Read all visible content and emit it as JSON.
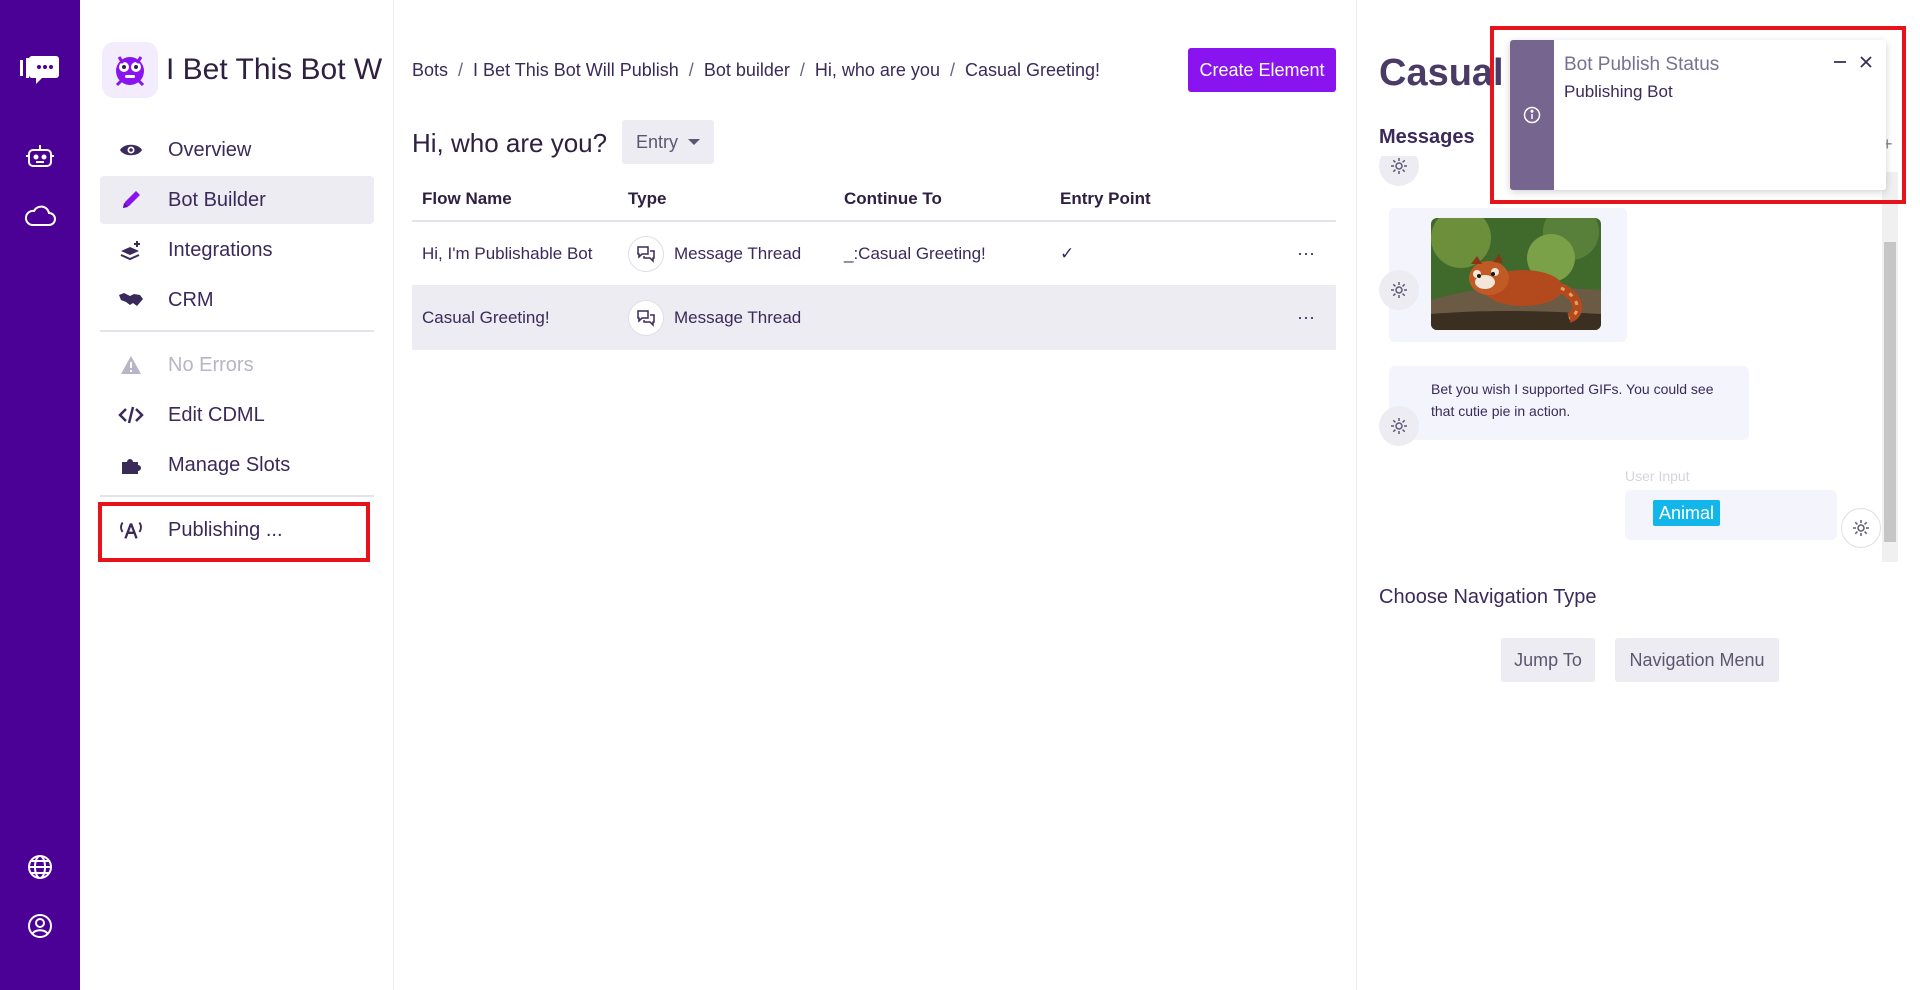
{
  "app": {
    "bot_name": "I Bet This Bot W"
  },
  "sidebar": {
    "items": [
      {
        "label": "Overview",
        "icon": "eye-icon"
      },
      {
        "label": "Bot Builder",
        "icon": "pencil-icon",
        "active": true
      },
      {
        "label": "Integrations",
        "icon": "layers-plus-icon"
      },
      {
        "label": "CRM",
        "icon": "handshake-icon"
      },
      {
        "label": "No Errors",
        "icon": "warning-icon",
        "disabled": true
      },
      {
        "label": "Edit CDML",
        "icon": "code-icon"
      },
      {
        "label": "Manage Slots",
        "icon": "puzzle-icon"
      },
      {
        "label": "Publishing ...",
        "icon": "broadcast-icon"
      }
    ]
  },
  "breadcrumbs": [
    "Bots",
    "I Bet This Bot Will Publish",
    "Bot builder",
    "Hi, who are you",
    "Casual Greeting!"
  ],
  "toolbar": {
    "create_label": "Create Element"
  },
  "flow": {
    "title": "Hi, who are you?",
    "entry_label": "Entry"
  },
  "table": {
    "headers": [
      "Flow Name",
      "Type",
      "Continue To",
      "Entry Point"
    ],
    "rows": [
      {
        "name": "Hi, I'm Publishable Bot",
        "type": "Message Thread",
        "continue_to": "_:Casual Greeting!",
        "entry": "✓",
        "more": "···"
      },
      {
        "name": "Casual Greeting!",
        "type": "Message Thread",
        "continue_to": "",
        "entry": "",
        "more": "···"
      }
    ]
  },
  "panel": {
    "title": "Casual G",
    "messages_label": "Messages",
    "message_text": "Bet you wish I supported GIFs. You could see that cutie pie in action.",
    "user_input_label": "User Input",
    "slot_tag": "Animal",
    "nav_type_label": "Choose Navigation Type",
    "nav_buttons": [
      "Jump To",
      "Navigation Menu"
    ],
    "plus": "+"
  },
  "toast": {
    "title": "Bot Publish Status",
    "body": "Publishing Bot"
  },
  "colors": {
    "rail": "#4b0096",
    "accent": "#8a14f0",
    "highlight": "#e8131a",
    "tag": "#13b6ea"
  }
}
